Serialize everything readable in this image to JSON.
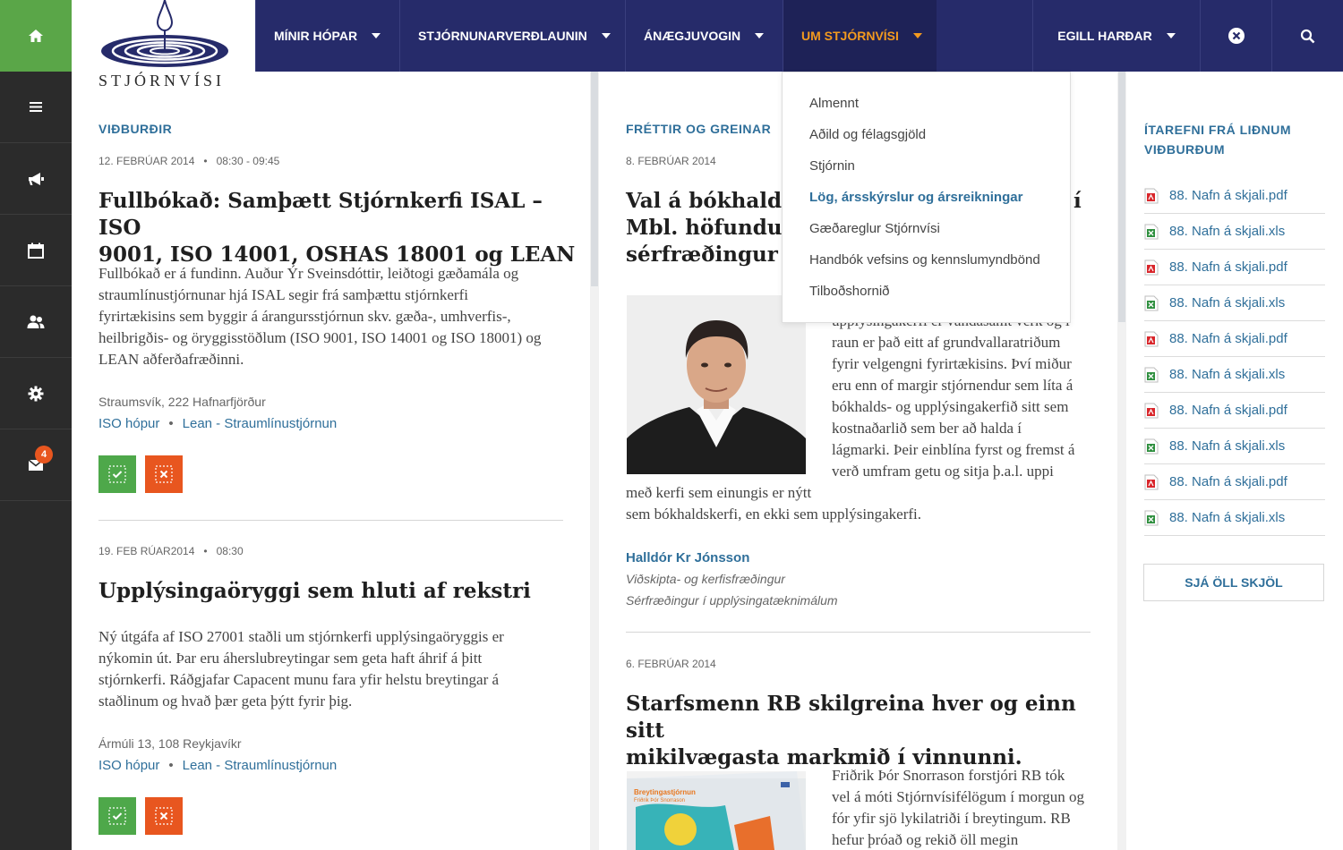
{
  "sidebar": {
    "items": [
      "home-icon",
      "menu-icon",
      "megaphone-icon",
      "calendar-icon",
      "group-icon",
      "gear-icon",
      "mail-icon"
    ],
    "mail_badge": "4"
  },
  "logo": {
    "text": "STJÓRNVÍSI"
  },
  "nav": {
    "items": [
      {
        "label": "MÍNIR HÓPAR"
      },
      {
        "label": "STJÓRNUNARVERÐLAUNIN"
      },
      {
        "label": "ÁNÆGJUVOGIN"
      },
      {
        "label": "UM STJÓRNVÍSI",
        "active": true
      }
    ],
    "user": "EGILL HARÐAR"
  },
  "colors": {
    "nav": "#262b6a",
    "green": "#5aa648",
    "orange": "#e8561f",
    "link": "#2f6f9a",
    "active_nav": "#f39a1f"
  },
  "events": {
    "title": "VIÐBURÐIR",
    "items": [
      {
        "date": "12. FEBRÚAR 2014",
        "time": "08:30 - 09:45",
        "headline_line1": "Fullbókað: Samþætt Stjórnkerfi ISAL – ISO",
        "headline_line2": "9001, ISO 14001, OSHAS 18001 og LEAN",
        "body": [
          "Fullbókað er á fundinn. Auður Ýr Sveinsdóttir, leiðtogi gæðamála og",
          "straumlínustjórnunar hjá ISAL segir frá samþættu stjórnkerfi",
          "fyrirtækisins sem byggir á árangursstjórnun skv. gæða-, umhverfis-,",
          "heilbrigðis- og öryggisstöðlum (ISO 9001, ISO 14001 og ISO 18001) og",
          "LEAN aðferðafræðinni."
        ],
        "location": "Straumsvík, 222 Hafnarfjörður",
        "tags": [
          "ISO hópur",
          "Lean - Straumlínustjórnun"
        ]
      },
      {
        "date": "19. FEB RÚAR2014",
        "time": "08:30",
        "headline_line1": "Upplýsingaöryggi sem hluti af rekstri",
        "body": [
          "Ný útgáfa af ISO 27001 staðli um stjórnkerfi upplýsingaöryggis er",
          "nýkomin út. Þar eru áherslubreytingar sem geta haft áhrif á þitt",
          "stjórnkerfi. Ráðgjafar Capacent munu fara yfir helstu breytingar á",
          "staðlinum og hvað þær geta þýtt fyrir þig."
        ],
        "location": "Ármúli 13, 108 Reykjavíkr",
        "tags": [
          "ISO hópur",
          "Lean - Straumlínustjórnun"
        ]
      }
    ]
  },
  "news": {
    "title": "FRÉTTIR OG GREINAR",
    "items": [
      {
        "date": "8. FEBRÚAR 2014",
        "headline": [
          "Val á bókhalds",
          "Mbl. höfundur",
          "sérfræðingur í"
        ],
        "headline_tail": "í",
        "body_right": [
          "upplýsingakerfi er vandasamt verk og í",
          "raun er það eitt af grundvallaratriðum",
          "fyrir velgengni fyrirtækisins. Því miður",
          "eru enn of margir stjórnendur sem líta á",
          "bókhalds- og upplýsingakerfið sitt sem",
          "kostnaðarlið sem ber að halda í",
          "lágmarki. Þeir einblína fyrst og fremst á",
          "verð umfram getu og sitja þ.a.l. uppi"
        ],
        "body_bottom": [
          "með kerfi sem einungis er nýtt",
          "sem bókhaldskerfi, en ekki sem upplýsingakerfi."
        ],
        "author": "Halldór Kr Jónsson",
        "roles": [
          "Viðskipta- og kerfisfræðingur",
          "Sérfræðingur í upplýsingatæknimálum"
        ]
      },
      {
        "date": "6. FEBRÚAR 2014",
        "headline": [
          "Starfsmenn RB skilgreina hver og einn sitt",
          "mikilvægasta markmið í vinnunni."
        ],
        "body_right": [
          "Friðrik Þór Snorrason forstjóri RB tók",
          "vel á móti Stjórnvísifélögum í morgun og",
          "fór yfir sjö lykilatriði í breytingum. RB",
          "hefur þróað og rekið öll megin"
        ],
        "image_text": [
          "Breytingastjórnun",
          "Friðrik Þór Snorrason"
        ]
      }
    ]
  },
  "dropdown": {
    "items": [
      "Almennt",
      "Aðild og félagsgjöld",
      "Stjórnin",
      "Lög, ársskýrslur og ársreikningar",
      "Gæðareglur Stjórnvísi",
      "Handbók vefsins og kennslumyndbönd",
      "Tilboðshornið"
    ],
    "active_index": 3
  },
  "files": {
    "title_line1": "ÍTAREFNI FRÁ LIÐNUM",
    "title_line2": "VIÐBURÐUM",
    "items": [
      {
        "name": "88. Nafn á skjali.pdf",
        "type": "pdf"
      },
      {
        "name": "88. Nafn á skjali.xls",
        "type": "xls"
      },
      {
        "name": "88. Nafn á skjali.pdf",
        "type": "pdf"
      },
      {
        "name": "88. Nafn á skjali.xls",
        "type": "xls"
      },
      {
        "name": "88. Nafn á skjali.pdf",
        "type": "pdf"
      },
      {
        "name": "88. Nafn á skjali.xls",
        "type": "xls"
      },
      {
        "name": "88. Nafn á skjali.pdf",
        "type": "pdf"
      },
      {
        "name": "88. Nafn á skjali.xls",
        "type": "xls"
      },
      {
        "name": "88. Nafn á skjali.pdf",
        "type": "pdf"
      },
      {
        "name": "88. Nafn á skjali.xls",
        "type": "xls"
      }
    ],
    "see_all": "SJÁ ÖLL SKJÖL"
  }
}
